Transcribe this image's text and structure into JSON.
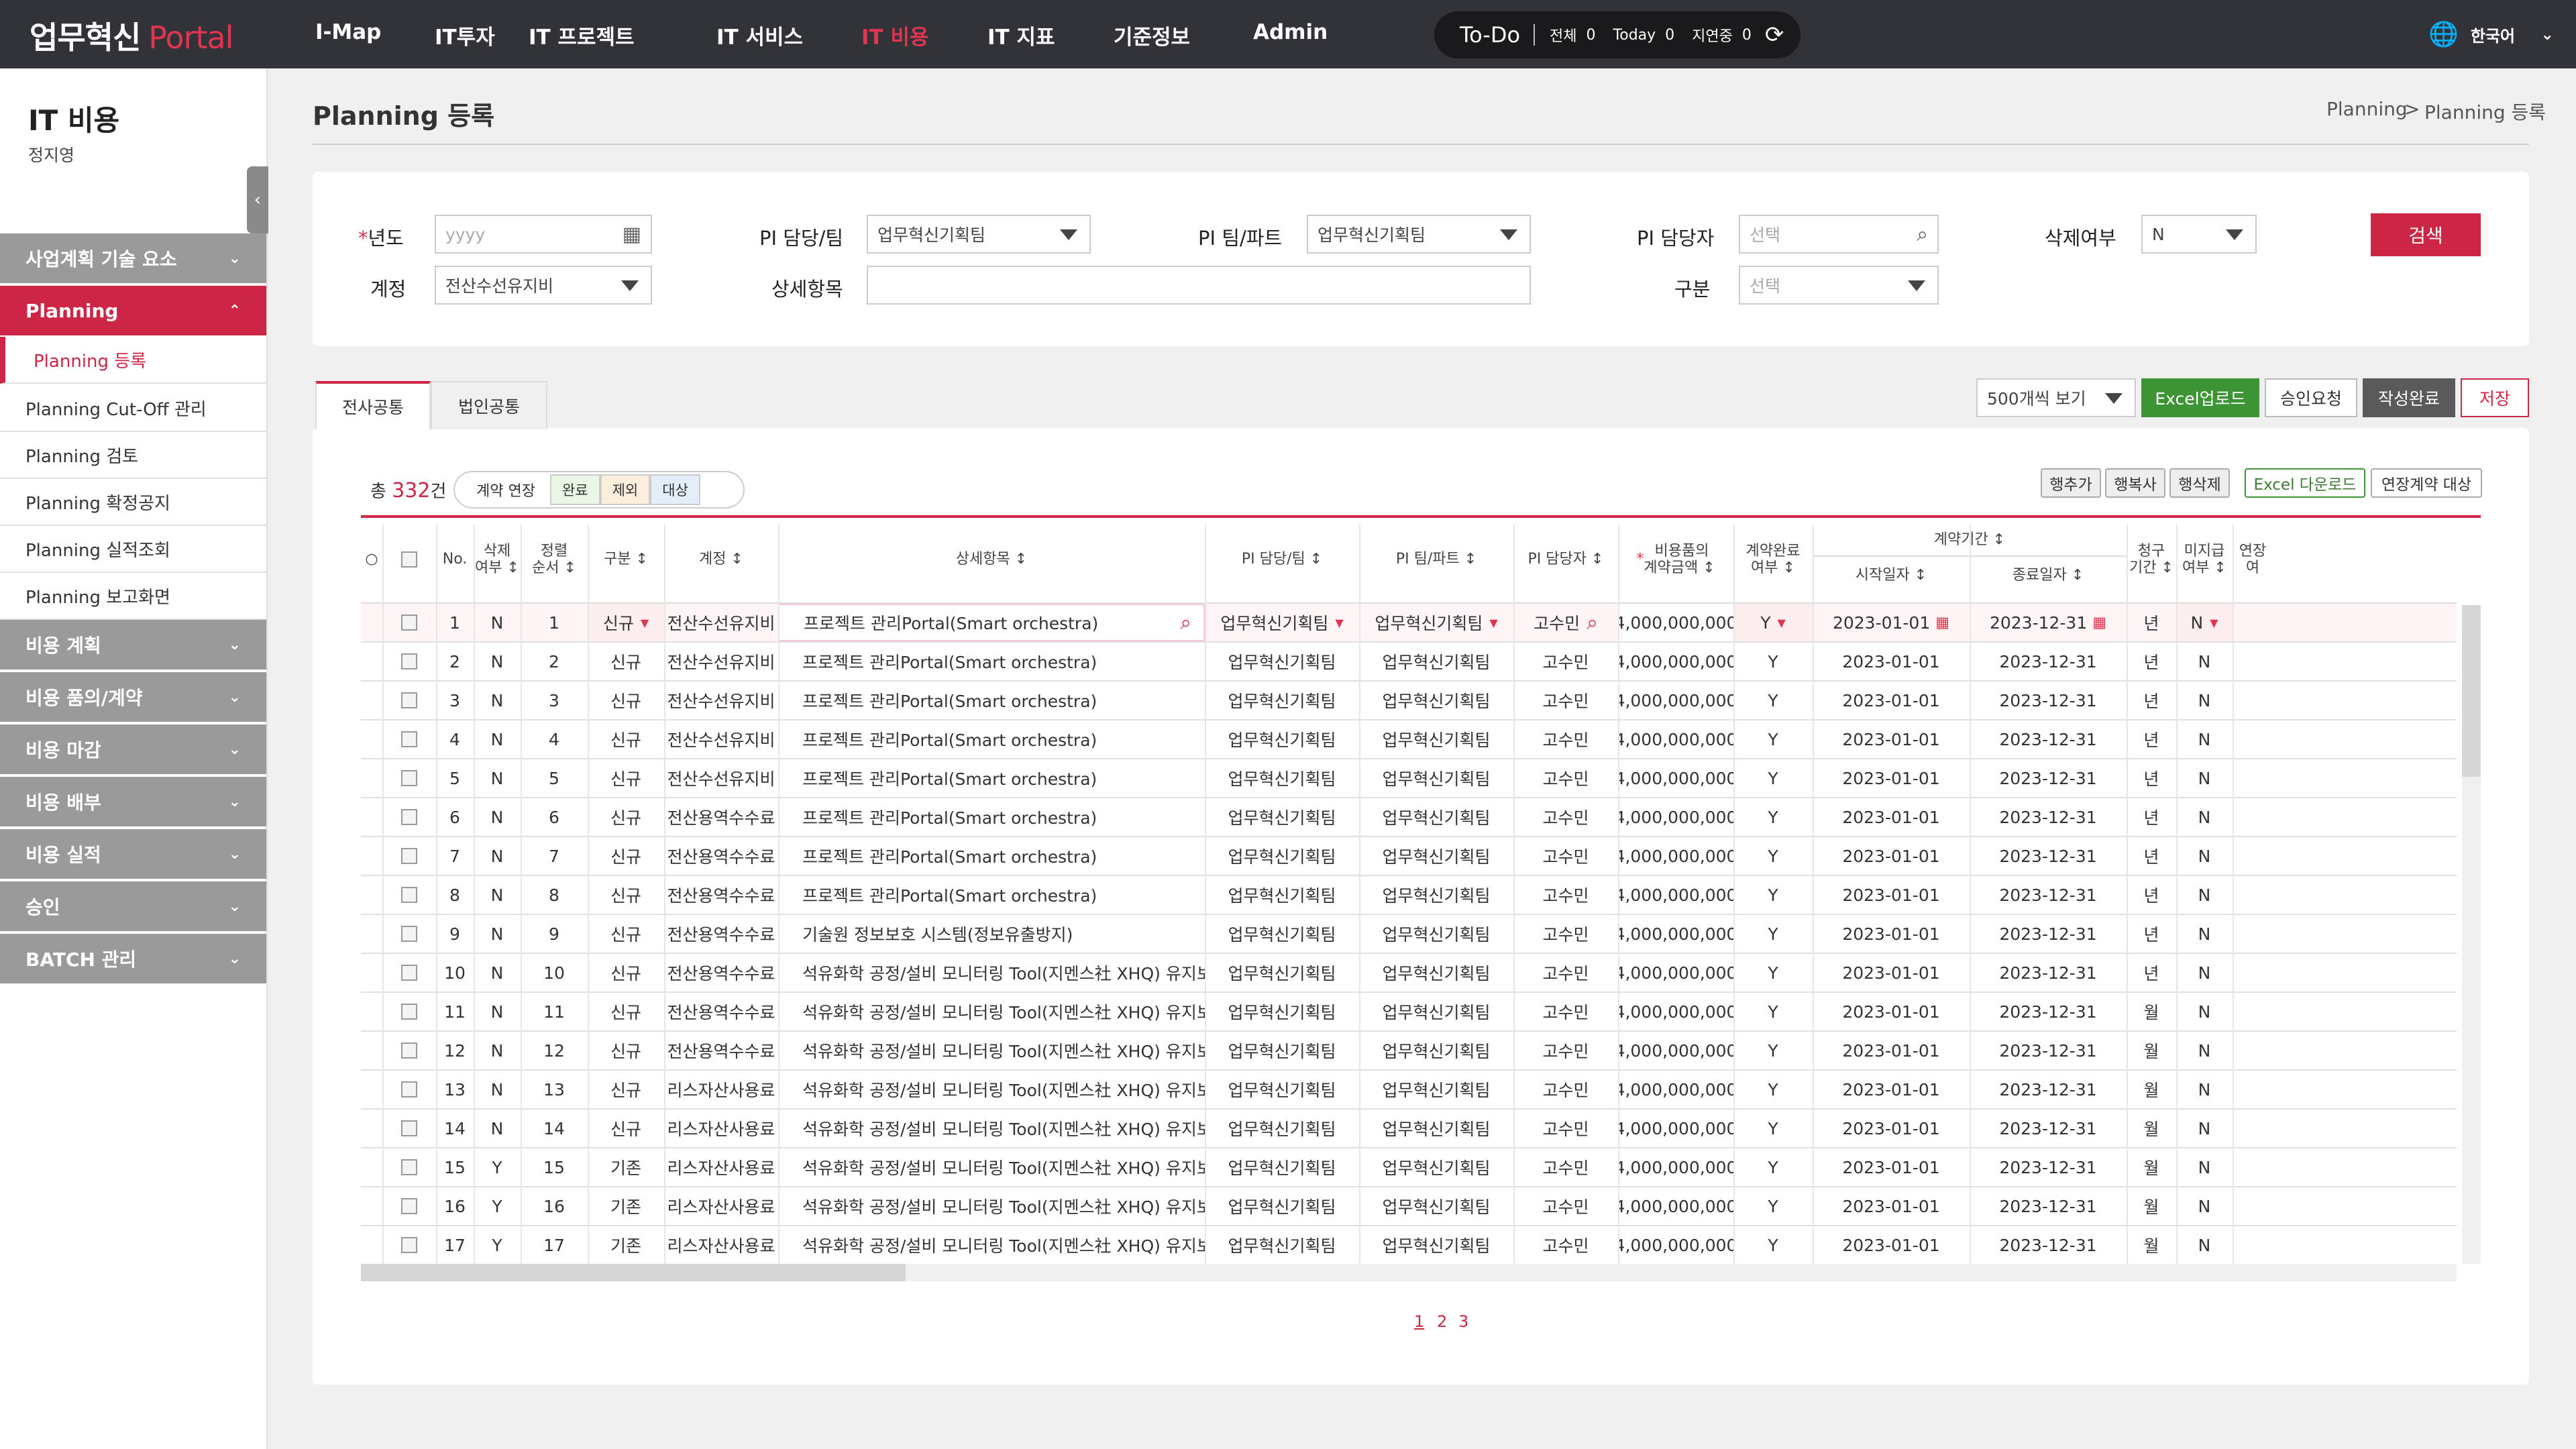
{
  "header": {
    "logo_main": "업무혁신",
    "logo_accent": "Portal",
    "nav": [
      "I-Map",
      "IT투자",
      "IT 프로젝트",
      "IT 서비스",
      "IT 비용",
      "IT 지표",
      "기준정보",
      "Admin"
    ],
    "active_nav": "IT 비용",
    "todo": {
      "title": "To-Do",
      "all_label": "전체",
      "all_count": "0",
      "today_label": "Today",
      "today_count": "0",
      "delay_label": "지연중",
      "delay_count": "0"
    },
    "language": "한국어"
  },
  "sidebar": {
    "title": "IT 비용",
    "user": "정지영",
    "menus": [
      {
        "label": "사업계획 기술 요소"
      },
      {
        "label": "Planning",
        "active": true
      }
    ],
    "submenus": [
      {
        "label": "Planning 등록",
        "active": true
      },
      {
        "label": "Planning Cut-Off 관리"
      },
      {
        "label": "Planning 검토"
      },
      {
        "label": "Planning 확정공지"
      },
      {
        "label": "Planning 실적조회"
      },
      {
        "label": "Planning 보고화면"
      }
    ],
    "menus_after": [
      {
        "label": "비용 계획"
      },
      {
        "label": "비용 품의/계약"
      },
      {
        "label": "비용 마감"
      },
      {
        "label": "비용 배부"
      },
      {
        "label": "비용 실적"
      },
      {
        "label": "승인"
      },
      {
        "label": "BATCH 관리"
      }
    ]
  },
  "page": {
    "title": "Planning 등록",
    "breadcrumb": [
      "Planning",
      "Planning 등록"
    ],
    "breadcrumb_sep": ">"
  },
  "search": {
    "year_label": "년도",
    "year_placeholder": "yyyy",
    "pi_team_label": "PI 담당/팀",
    "pi_team_value": "업무혁신기획팀",
    "pi_part_label": "PI 팀/파트",
    "pi_part_value": "업무혁신기획팀",
    "pi_owner_label": "PI 담당자",
    "pi_owner_placeholder": "선택",
    "delete_label": "삭제여부",
    "delete_value": "N",
    "account_label": "계정",
    "account_value": "전산수선유지비",
    "detail_label": "상세항목",
    "detail_value": "",
    "type_label": "구분",
    "type_placeholder": "선택",
    "search_button": "검색"
  },
  "tabs": [
    {
      "label": "전사공통",
      "active": true
    },
    {
      "label": "법인공통",
      "active": false
    }
  ],
  "toolbar": {
    "page_size": "500개씩 보기",
    "excel_upload": "Excel업로드",
    "approve_request": "승인요청",
    "complete": "작성완료",
    "save": "저장",
    "add_row": "행추가",
    "copy_row": "행복사",
    "delete_row": "행삭제",
    "excel_download": "Excel 다운로드",
    "extend_target": "연장계약 대상"
  },
  "summary": {
    "total_prefix": "총",
    "total_count": "332",
    "total_suffix": "건",
    "legend_title": "계약 연장",
    "legend_done": "완료",
    "legend_exclude": "제외",
    "legend_target": "대상"
  },
  "table": {
    "headers": {
      "radio": "○",
      "no": "No.",
      "deleted": "삭제\n여부 ↕",
      "order": "정렬\n순서 ↕",
      "type": "구분 ↕",
      "account": "계정 ↕",
      "detail": "상세항목 ↕",
      "pi_team": "PI 담당/팀 ↕",
      "pi_part": "PI 팀/파트 ↕",
      "pi_owner": "PI 담당자 ↕",
      "amount": "비용품의\n계약금액 ↕",
      "contract_done": "계약완료\n여부 ↕",
      "period": "계약기간 ↕",
      "start": "시작일자 ↕",
      "end": "종료일자 ↕",
      "billing": "청구\n기간 ↕",
      "unpaid": "미지급\n여부 ↕",
      "extend": "연장\n여"
    },
    "rows": [
      {
        "no": "1",
        "del": "N",
        "ord": "1",
        "type": "신규",
        "acct": "전산수선유지비",
        "detail": "프로젝트 관리Portal(Smart orchestra)",
        "team": "업무혁신기획팀",
        "part": "업무혁신기획팀",
        "owner": "고수민",
        "amount": "4,000,000,000",
        "done": "Y",
        "start": "2023-01-01",
        "end": "2023-12-31",
        "bill": "년",
        "unpaid": "N"
      },
      {
        "no": "2",
        "del": "N",
        "ord": "2",
        "type": "신규",
        "acct": "전산수선유지비",
        "detail": "프로젝트 관리Portal(Smart orchestra)",
        "team": "업무혁신기획팀",
        "part": "업무혁신기획팀",
        "owner": "고수민",
        "amount": "4,000,000,000",
        "done": "Y",
        "start": "2023-01-01",
        "end": "2023-12-31",
        "bill": "년",
        "unpaid": "N"
      },
      {
        "no": "3",
        "del": "N",
        "ord": "3",
        "type": "신규",
        "acct": "전산수선유지비",
        "detail": "프로젝트 관리Portal(Smart orchestra)",
        "team": "업무혁신기획팀",
        "part": "업무혁신기획팀",
        "owner": "고수민",
        "amount": "4,000,000,000",
        "done": "Y",
        "start": "2023-01-01",
        "end": "2023-12-31",
        "bill": "년",
        "unpaid": "N"
      },
      {
        "no": "4",
        "del": "N",
        "ord": "4",
        "type": "신규",
        "acct": "전산수선유지비",
        "detail": "프로젝트 관리Portal(Smart orchestra)",
        "team": "업무혁신기획팀",
        "part": "업무혁신기획팀",
        "owner": "고수민",
        "amount": "4,000,000,000",
        "done": "Y",
        "start": "2023-01-01",
        "end": "2023-12-31",
        "bill": "년",
        "unpaid": "N"
      },
      {
        "no": "5",
        "del": "N",
        "ord": "5",
        "type": "신규",
        "acct": "전산수선유지비",
        "detail": "프로젝트 관리Portal(Smart orchestra)",
        "team": "업무혁신기획팀",
        "part": "업무혁신기획팀",
        "owner": "고수민",
        "amount": "4,000,000,000",
        "done": "Y",
        "start": "2023-01-01",
        "end": "2023-12-31",
        "bill": "년",
        "unpaid": "N"
      },
      {
        "no": "6",
        "del": "N",
        "ord": "6",
        "type": "신규",
        "acct": "전산용역수수료",
        "detail": "프로젝트 관리Portal(Smart orchestra)",
        "team": "업무혁신기획팀",
        "part": "업무혁신기획팀",
        "owner": "고수민",
        "amount": "4,000,000,000",
        "done": "Y",
        "start": "2023-01-01",
        "end": "2023-12-31",
        "bill": "년",
        "unpaid": "N"
      },
      {
        "no": "7",
        "del": "N",
        "ord": "7",
        "type": "신규",
        "acct": "전산용역수수료",
        "detail": "프로젝트 관리Portal(Smart orchestra)",
        "team": "업무혁신기획팀",
        "part": "업무혁신기획팀",
        "owner": "고수민",
        "amount": "4,000,000,000",
        "done": "Y",
        "start": "2023-01-01",
        "end": "2023-12-31",
        "bill": "년",
        "unpaid": "N"
      },
      {
        "no": "8",
        "del": "N",
        "ord": "8",
        "type": "신규",
        "acct": "전산용역수수료",
        "detail": "프로젝트 관리Portal(Smart orchestra)",
        "team": "업무혁신기획팀",
        "part": "업무혁신기획팀",
        "owner": "고수민",
        "amount": "4,000,000,000",
        "done": "Y",
        "start": "2023-01-01",
        "end": "2023-12-31",
        "bill": "년",
        "unpaid": "N"
      },
      {
        "no": "9",
        "del": "N",
        "ord": "9",
        "type": "신규",
        "acct": "전산용역수수료",
        "detail": "기술원 정보보호 시스템(정보유출방지)",
        "team": "업무혁신기획팀",
        "part": "업무혁신기획팀",
        "owner": "고수민",
        "amount": "4,000,000,000",
        "done": "Y",
        "start": "2023-01-01",
        "end": "2023-12-31",
        "bill": "년",
        "unpaid": "N"
      },
      {
        "no": "10",
        "del": "N",
        "ord": "10",
        "type": "신규",
        "acct": "전산용역수수료",
        "detail": "석유화학 공정/설비 모니터링 Tool(지멘스社 XHQ) 유지보수",
        "team": "업무혁신기획팀",
        "part": "업무혁신기획팀",
        "owner": "고수민",
        "amount": "4,000,000,000",
        "done": "Y",
        "start": "2023-01-01",
        "end": "2023-12-31",
        "bill": "년",
        "unpaid": "N"
      },
      {
        "no": "11",
        "del": "N",
        "ord": "11",
        "type": "신규",
        "acct": "전산용역수수료",
        "detail": "석유화학 공정/설비 모니터링 Tool(지멘스社 XHQ) 유지보수",
        "team": "업무혁신기획팀",
        "part": "업무혁신기획팀",
        "owner": "고수민",
        "amount": "4,000,000,000",
        "done": "Y",
        "start": "2023-01-01",
        "end": "2023-12-31",
        "bill": "월",
        "unpaid": "N"
      },
      {
        "no": "12",
        "del": "N",
        "ord": "12",
        "type": "신규",
        "acct": "전산용역수수료",
        "detail": "석유화학 공정/설비 모니터링 Tool(지멘스社 XHQ) 유지보수",
        "team": "업무혁신기획팀",
        "part": "업무혁신기획팀",
        "owner": "고수민",
        "amount": "4,000,000,000",
        "done": "Y",
        "start": "2023-01-01",
        "end": "2023-12-31",
        "bill": "월",
        "unpaid": "N"
      },
      {
        "no": "13",
        "del": "N",
        "ord": "13",
        "type": "신규",
        "acct": "리스자산사용료",
        "detail": "석유화학 공정/설비 모니터링 Tool(지멘스社 XHQ) 유지보수",
        "team": "업무혁신기획팀",
        "part": "업무혁신기획팀",
        "owner": "고수민",
        "amount": "4,000,000,000",
        "done": "Y",
        "start": "2023-01-01",
        "end": "2023-12-31",
        "bill": "월",
        "unpaid": "N"
      },
      {
        "no": "14",
        "del": "N",
        "ord": "14",
        "type": "신규",
        "acct": "리스자산사용료",
        "detail": "석유화학 공정/설비 모니터링 Tool(지멘스社 XHQ) 유지보수",
        "team": "업무혁신기획팀",
        "part": "업무혁신기획팀",
        "owner": "고수민",
        "amount": "4,000,000,000",
        "done": "Y",
        "start": "2023-01-01",
        "end": "2023-12-31",
        "bill": "월",
        "unpaid": "N"
      },
      {
        "no": "15",
        "del": "Y",
        "ord": "15",
        "type": "기존",
        "acct": "리스자산사용료",
        "detail": "석유화학 공정/설비 모니터링 Tool(지멘스社 XHQ) 유지보수",
        "team": "업무혁신기획팀",
        "part": "업무혁신기획팀",
        "owner": "고수민",
        "amount": "4,000,000,000",
        "done": "Y",
        "start": "2023-01-01",
        "end": "2023-12-31",
        "bill": "월",
        "unpaid": "N"
      },
      {
        "no": "16",
        "del": "Y",
        "ord": "16",
        "type": "기존",
        "acct": "리스자산사용료",
        "detail": "석유화학 공정/설비 모니터링 Tool(지멘스社 XHQ) 유지보수",
        "team": "업무혁신기획팀",
        "part": "업무혁신기획팀",
        "owner": "고수민",
        "amount": "4,000,000,000",
        "done": "Y",
        "start": "2023-01-01",
        "end": "2023-12-31",
        "bill": "월",
        "unpaid": "N"
      },
      {
        "no": "17",
        "del": "Y",
        "ord": "17",
        "type": "기존",
        "acct": "리스자산사용료",
        "detail": "석유화학 공정/설비 모니터링 Tool(지멘스社 XHQ) 유지보수",
        "team": "업무혁신기획팀",
        "part": "업무혁신기획팀",
        "owner": "고수민",
        "amount": "4,000,000,000",
        "done": "Y",
        "start": "2023-01-01",
        "end": "2023-12-31",
        "bill": "월",
        "unpaid": "N"
      }
    ]
  },
  "pagination": [
    "1",
    "2",
    "3"
  ],
  "colors": {
    "accent": "#cc2546",
    "topbar": "#323338",
    "green": "#3d9435"
  },
  "icons": {
    "calendar": "calendar-icon",
    "search": "search-icon",
    "refresh": "refresh-icon",
    "globe": "globe-icon",
    "chevron": "chevron-down-icon"
  }
}
